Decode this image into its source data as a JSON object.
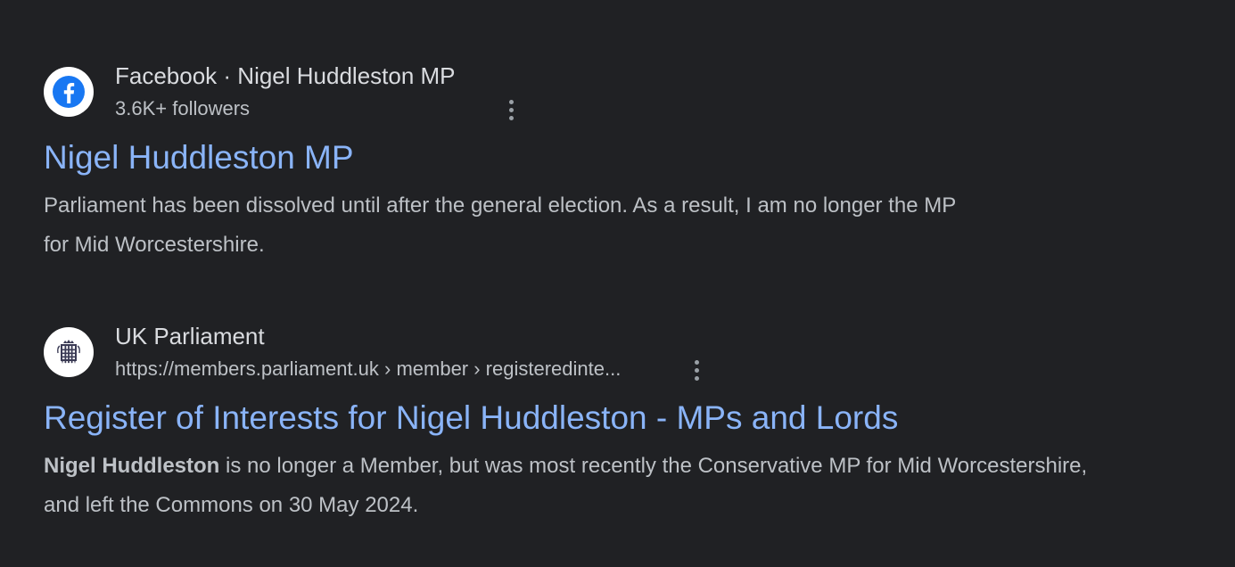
{
  "results": [
    {
      "site_name": "Facebook · Nigel Huddleston MP",
      "site_sub": "3.6K+ followers",
      "favicon": "facebook-icon",
      "title": "Nigel Huddleston MP",
      "snippet_bold": "",
      "snippet": "Parliament has been dissolved until after the general election. As a result, I am no longer the MP for Mid Worcestershire."
    },
    {
      "site_name": "UK Parliament",
      "site_sub": "https://members.parliament.uk › member › registeredinte...",
      "favicon": "portcullis-icon",
      "title": "Register of Interests for Nigel Huddleston - MPs and Lords",
      "snippet_bold": "Nigel Huddleston",
      "snippet": " is no longer a Member, but was most recently the Conservative MP for Mid Worcestershire, and left the Commons on 30 May 2024."
    }
  ],
  "colors": {
    "background": "#202124",
    "link": "#8ab4f8",
    "text": "#bdc1c6",
    "facebook_blue": "#1877f2"
  }
}
